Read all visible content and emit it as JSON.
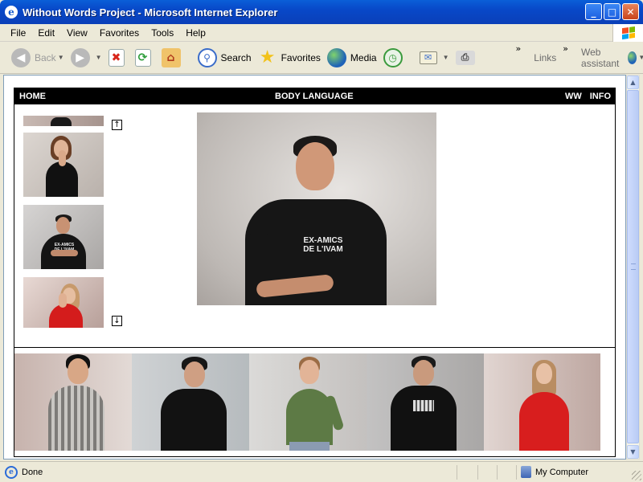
{
  "window": {
    "title": "Without Words Project - Microsoft Internet Explorer",
    "icon": "ie-icon",
    "controls": {
      "minimize": "_",
      "maximize": "□",
      "close": "✕"
    }
  },
  "menubar": {
    "items": [
      "File",
      "Edit",
      "View",
      "Favorites",
      "Tools",
      "Help"
    ]
  },
  "toolbar": {
    "back": "Back",
    "search": "Search",
    "favorites": "Favorites",
    "media": "Media",
    "links": "Links",
    "web_assistant": "Web assistant"
  },
  "site": {
    "nav_home": "HOME",
    "section_title": "BODY LANGUAGE",
    "nav_ww": "WW",
    "nav_info": "INFO",
    "scroll_up": "↑",
    "scroll_down": "↓",
    "main_shirt_text": "EX-AMICS\nDE L'IVAM",
    "thumb_shirt_text": "EX-AMICS\nDE L'IVAM"
  },
  "statusbar": {
    "status": "Done",
    "zone": "My Computer"
  },
  "colors": {
    "titlebar": "#0a5fd8",
    "chrome": "#ece9d8",
    "site_header": "#000000",
    "link": "#ffffff"
  }
}
